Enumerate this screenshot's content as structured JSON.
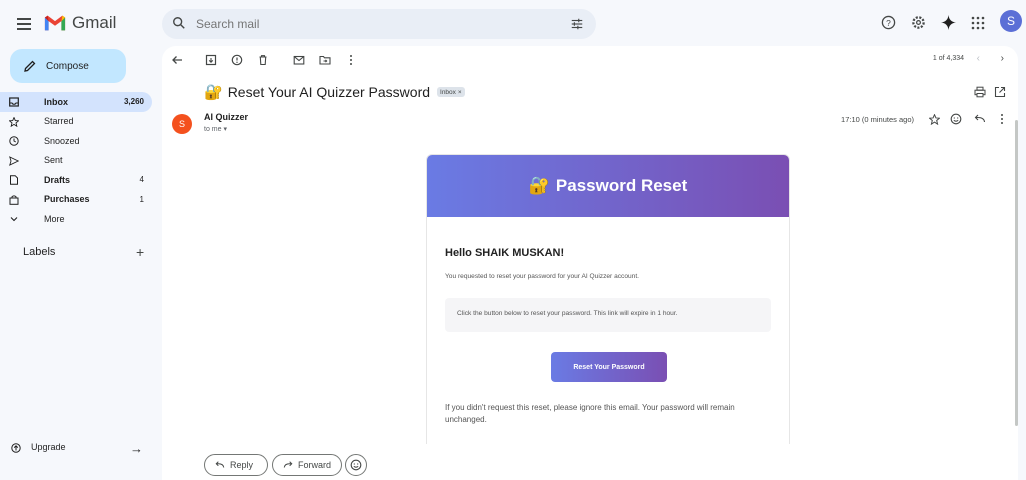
{
  "app": {
    "title": "Gmail"
  },
  "search": {
    "placeholder": "Search mail"
  },
  "sidebar": {
    "compose_label": "Compose",
    "items": [
      {
        "label": "Inbox",
        "count": "3,260",
        "active": true
      },
      {
        "label": "Starred",
        "count": ""
      },
      {
        "label": "Snoozed",
        "count": ""
      },
      {
        "label": "Sent",
        "count": ""
      },
      {
        "label": "Drafts",
        "count": "4"
      },
      {
        "label": "Purchases",
        "count": "1"
      },
      {
        "label": "More",
        "count": ""
      }
    ],
    "labels_title": "Labels",
    "upgrade_label": "Upgrade"
  },
  "toolbar": {
    "pager": "1 of 4,334"
  },
  "message": {
    "subject_emoji": "🔐",
    "subject": "Reset Your AI Quizzer Password",
    "badge": "Inbox",
    "sender_initial": "S",
    "sender": "AI Quizzer",
    "to": "to me ▾",
    "time": "17:10 (0 minutes ago)"
  },
  "email": {
    "header_emoji": "🔐",
    "header_title": "Password Reset",
    "greeting": "Hello SHAIK MUSKAN!",
    "line1": "You requested to reset your password for your AI Quizzer account.",
    "notice": "Click the button below to reset your password. This link will expire in 1 hour.",
    "button": "Reset Your Password",
    "line2": "If you didn't request this reset, please ignore this email. Your password will remain unchanged."
  },
  "actions": {
    "reply": "Reply",
    "forward": "Forward"
  },
  "user": {
    "initial": "S"
  },
  "colors": {
    "accent_start": "#6a7be4",
    "accent_end": "#7a4fb3",
    "sender_avatar": "#f4511e",
    "compose_bg": "#c2e7ff",
    "active_nav": "#d3e3fd"
  }
}
